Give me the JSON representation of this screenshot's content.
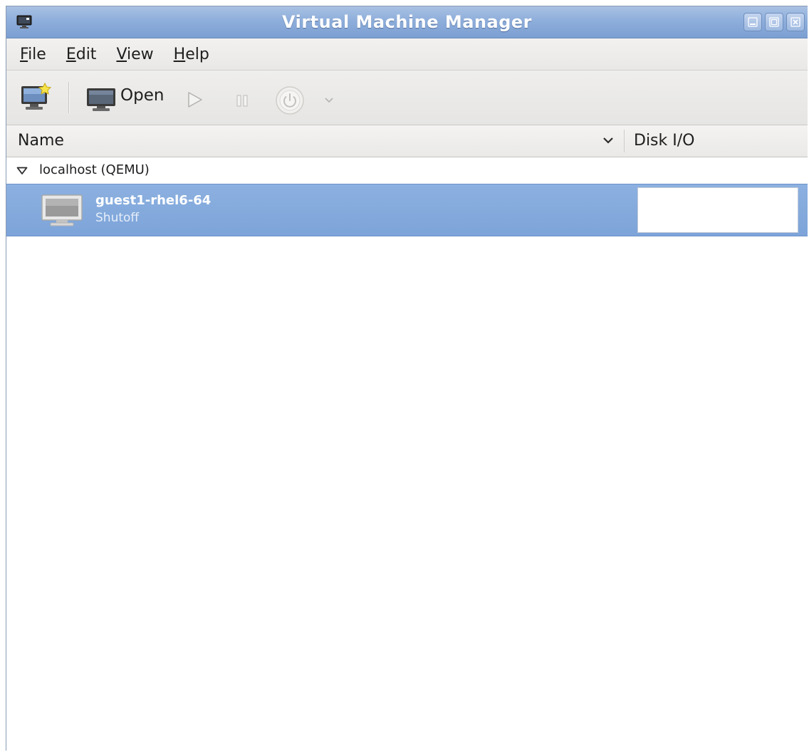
{
  "window": {
    "title": "Virtual Machine Manager"
  },
  "menubar": {
    "items": [
      "File",
      "Edit",
      "View",
      "Help"
    ]
  },
  "toolbar": {
    "new_vm_icon": "new-vm-icon",
    "open_label": "Open",
    "run_icon": "play-icon",
    "pause_icon": "pause-icon",
    "shutdown_icon": "power-icon",
    "shutdown_menu_icon": "chevron-down-icon"
  },
  "columns": {
    "name": "Name",
    "disk_io": "Disk I/O"
  },
  "tree": {
    "host": {
      "label": "localhost (QEMU)",
      "expanded": true
    },
    "vms": [
      {
        "name": "guest1-rhel6-64",
        "status": "Shutoff",
        "selected": true
      }
    ]
  },
  "colors": {
    "titlebar": "#8eaedb",
    "selection": "#7da4d9",
    "selection_text": "#ffffff"
  }
}
